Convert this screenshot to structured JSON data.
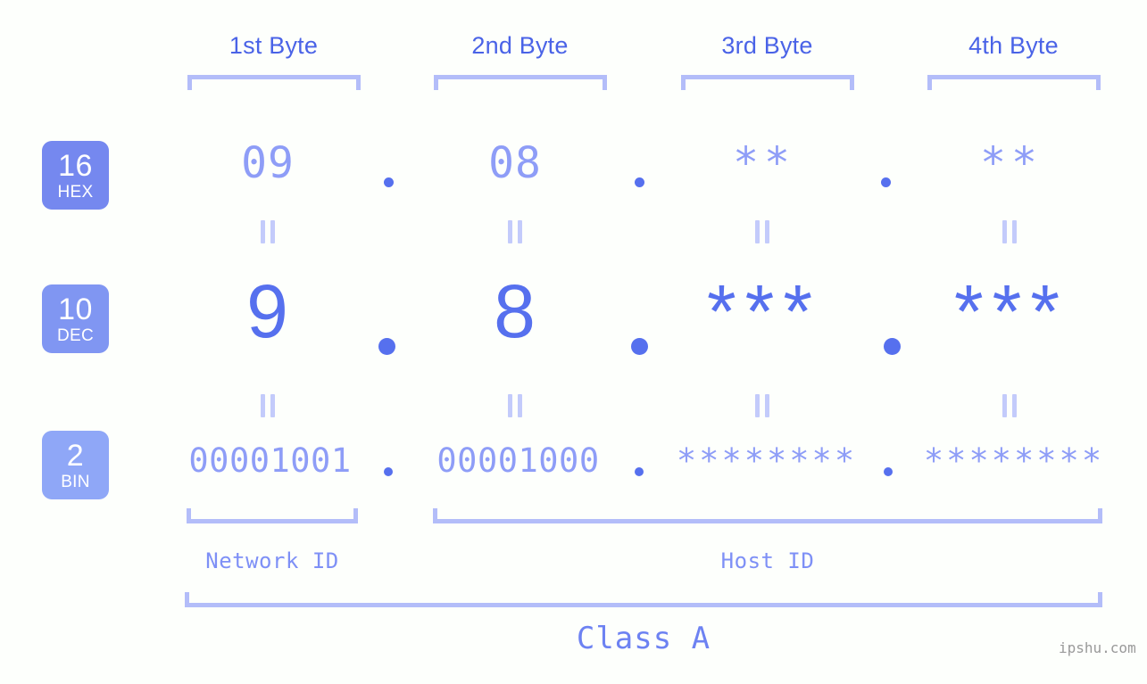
{
  "headers": [
    {
      "label": "1st Byte"
    },
    {
      "label": "2nd Byte"
    },
    {
      "label": "3rd Byte"
    },
    {
      "label": "4th Byte"
    }
  ],
  "rows": [
    {
      "base_number": "16",
      "base_name": "HEX",
      "badge_color": "#7588ef",
      "values": [
        "09",
        "08",
        "**",
        "**"
      ],
      "separator": "."
    },
    {
      "base_number": "10",
      "base_name": "DEC",
      "badge_color": "#8096f2",
      "values": [
        "9",
        "8",
        "***",
        "***"
      ],
      "separator": "."
    },
    {
      "base_number": "2",
      "base_name": "BIN",
      "badge_color": "#8fa7f7",
      "values": [
        "00001001",
        "00001000",
        "********",
        "********"
      ],
      "separator": "."
    }
  ],
  "equals_symbol": "=",
  "sections": [
    {
      "label": "Network ID"
    },
    {
      "label": "Host ID"
    }
  ],
  "class": {
    "label": "Class A"
  },
  "watermark": {
    "text": "ipshu.com"
  },
  "colors": {
    "background": "#fdfffc",
    "header_text": "#4a63e7",
    "accent_light": "#b3bdf9",
    "accent_mid": "#8e9df7",
    "accent_strong": "#5670ee"
  }
}
